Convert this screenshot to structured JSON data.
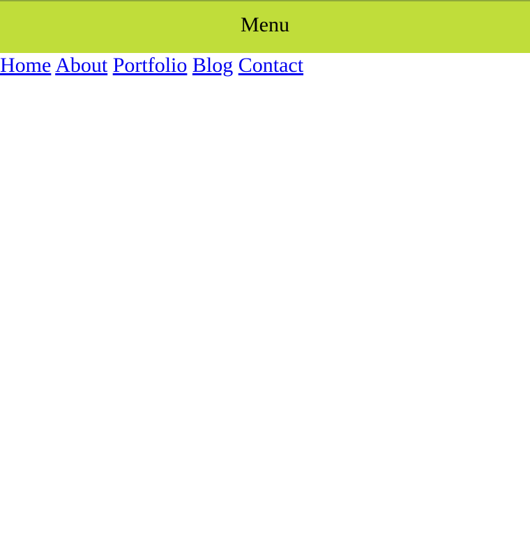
{
  "colors": {
    "menu_bar_bg": "#c0dd3a",
    "link": "#0000ee"
  },
  "menu": {
    "label": "Menu"
  },
  "nav": {
    "links": [
      "Home",
      "About",
      "Portfolio",
      "Blog",
      "Contact"
    ]
  }
}
